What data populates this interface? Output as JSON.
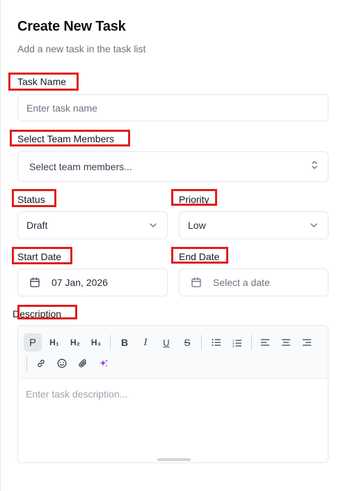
{
  "form": {
    "title": "Create New Task",
    "subtitle": "Add a new task in the task list",
    "task_name": {
      "label": "Task Name",
      "placeholder": "Enter task name"
    },
    "team_members": {
      "label": "Select Team Members",
      "placeholder": "Select team members..."
    },
    "status": {
      "label": "Status",
      "value": "Draft"
    },
    "priority": {
      "label": "Priority",
      "value": "Low"
    },
    "start_date": {
      "label": "Start Date",
      "value": "07 Jan, 2026"
    },
    "end_date": {
      "label": "End Date",
      "placeholder": "Select a date"
    },
    "description": {
      "label": "Description",
      "placeholder": "Enter task description..."
    }
  },
  "toolbar": {
    "paragraph": "P",
    "h1": "H₁",
    "h2": "H₂",
    "h3": "H₃",
    "bold": "B",
    "italic": "I",
    "underline": "U",
    "strike": "S"
  },
  "colors": {
    "highlight": "#e11d1d",
    "ai_accent": "#9333ea"
  }
}
